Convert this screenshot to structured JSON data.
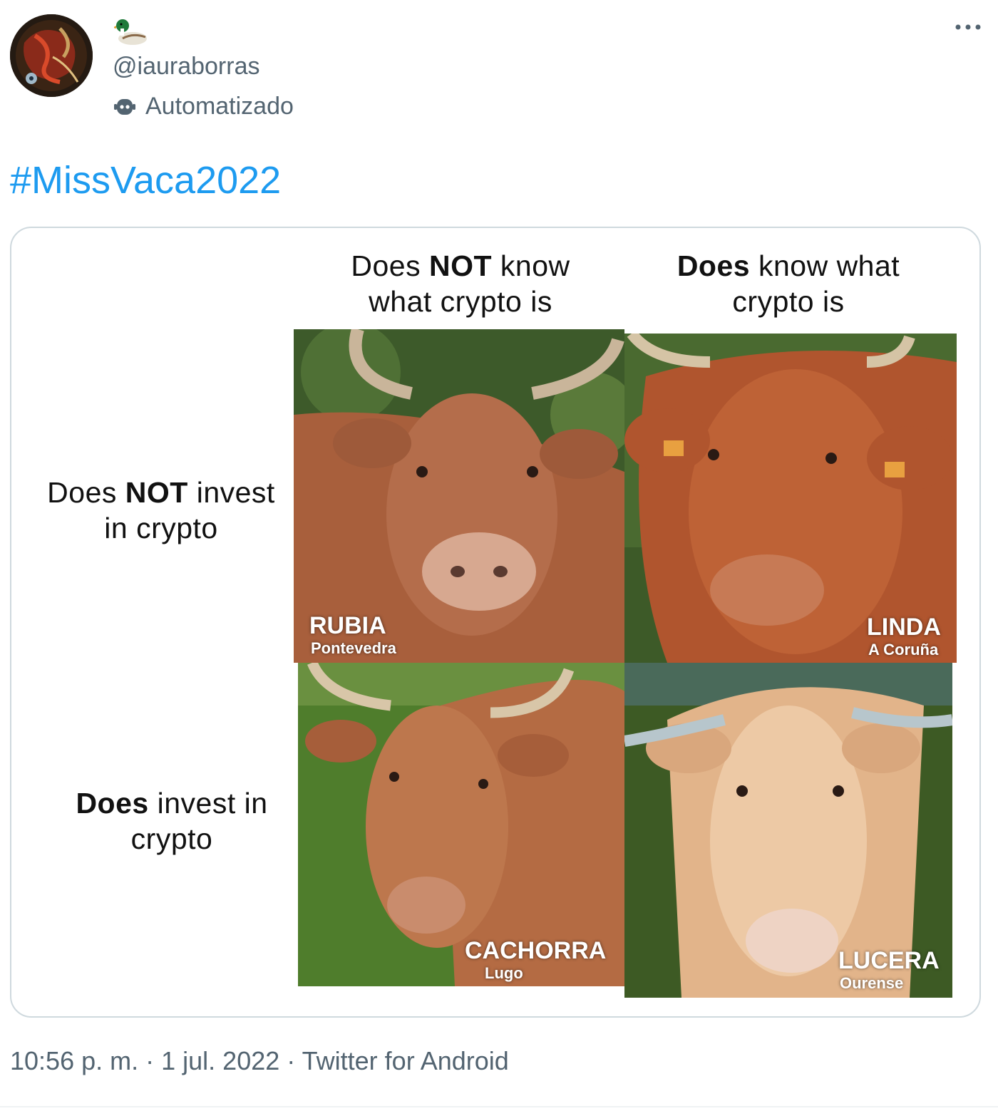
{
  "tweet": {
    "display_name_emoji": "duck-emoji",
    "handle": "@iauraborras",
    "automated_label": "Automatizado",
    "text": "#MissVaca2022",
    "timestamp": "10:56 p. m.",
    "separator": "·",
    "date": "1 jul. 2022",
    "source": "Twitter for Android"
  },
  "meme": {
    "col_headers": [
      {
        "pre": "Does ",
        "bold": "NOT",
        "post": " know",
        "line2": "what crypto is"
      },
      {
        "pre": "",
        "bold": "Does",
        "post": " know what",
        "line2": "crypto is"
      }
    ],
    "row_headers": [
      {
        "pre": "Does ",
        "bold": "NOT",
        "post": " invest",
        "line2": "in crypto"
      },
      {
        "pre": "",
        "bold": "Does",
        "post": " invest in",
        "line2": "crypto"
      }
    ],
    "cows": [
      {
        "name": "RUBIA",
        "place": "Pontevedra"
      },
      {
        "name": "LINDA",
        "place": "A Coruña"
      },
      {
        "name": "CACHORRA",
        "place": "Lugo"
      },
      {
        "name": "LUCERA",
        "place": "Ourense"
      }
    ]
  },
  "colors": {
    "link": "#1d9bf0",
    "secondary": "#536471",
    "border": "#cfd9de"
  }
}
